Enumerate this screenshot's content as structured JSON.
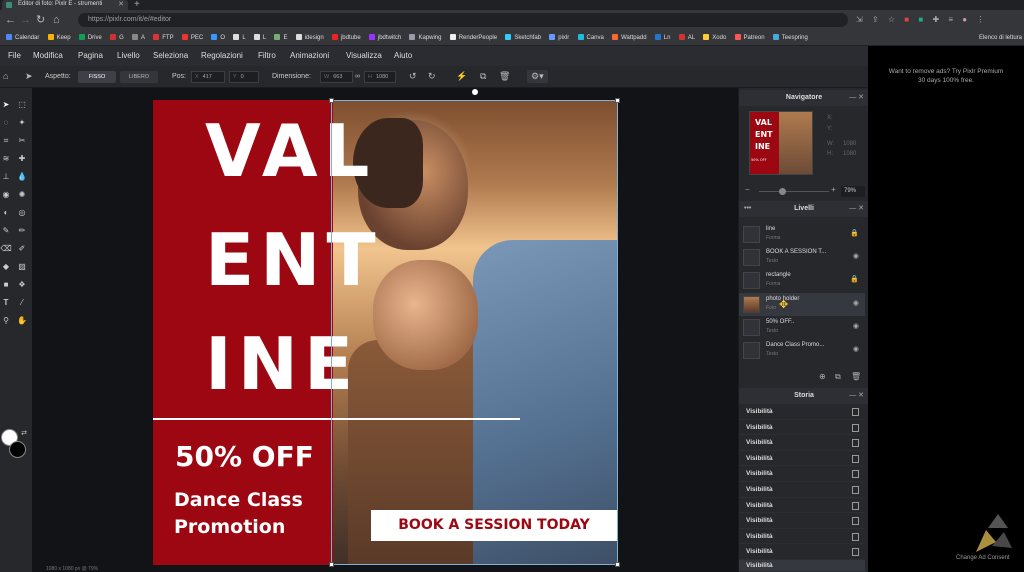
{
  "browser": {
    "tab_title": "Editor di foto: Pixlr E - strumenti",
    "url": "https://pixlr.com/it/e/#editor",
    "bookmarks": [
      "Calendar",
      "Keep",
      "Drive",
      "G",
      "A",
      "FTP",
      "PEC",
      "O",
      "L",
      "L",
      "E",
      "idesign",
      "jbdtube",
      "jbdtwitch",
      "Kapwing",
      "RenderPeople",
      "Sketchfab",
      "pixlr",
      "Canva",
      "Wattpadd",
      "Ln",
      "AL",
      "Xodo",
      "Patreon",
      "Teespring"
    ],
    "bookmarks_end": "Elenco di lettura"
  },
  "menu": [
    "File",
    "Modifica",
    "Pagina",
    "Livello",
    "Seleziona",
    "Regolazioni",
    "Filtro",
    "Animazioni",
    "Visualizza",
    "Aiuto"
  ],
  "toolbar": {
    "aspect_label": "Aspetto:",
    "fixed": "FISSO",
    "free": "LIBERO",
    "pos_label": "Pos:",
    "x_label": "X",
    "x_value": "417",
    "y_label": "Y",
    "y_value": "0",
    "size_label": "Dimensione:",
    "w_label": "W",
    "w_value": "663",
    "h_label": "H",
    "h_value": "1080"
  },
  "canvas": {
    "title_lines": [
      "VAL",
      "ENT",
      "INE"
    ],
    "offer": "50% OFF",
    "line1": "Dance Class",
    "line2": "Promotion",
    "cta": "BOOK A SESSION TODAY",
    "status": "1080 x 1080 px @ 79%"
  },
  "navigator": {
    "title": "Navigatore",
    "x": "X:",
    "y": "Y:",
    "w_label": "W:",
    "w_value": "1080",
    "h_label": "H:",
    "h_value": "1080",
    "zoom": "79%",
    "thumb_title": "VAL ENT INE",
    "thumb_offer": "50% OFF"
  },
  "layers": {
    "title": "Livelli",
    "items": [
      {
        "name": "line",
        "type": "Forma",
        "icon": "lock-icon"
      },
      {
        "name": "BOOK A SESSION T...",
        "type": "Testo",
        "icon": "eye-icon"
      },
      {
        "name": "rectangle",
        "type": "Forma",
        "icon": "lock-icon"
      },
      {
        "name": "photo holder",
        "type": "Foto",
        "icon": "eye-icon",
        "selected": true
      },
      {
        "name": "50% OFF..",
        "type": "Testo",
        "icon": "eye-icon"
      },
      {
        "name": "Dance Class Promo...",
        "type": "Testo",
        "icon": "eye-icon"
      }
    ]
  },
  "history": {
    "title": "Storia",
    "items": [
      "Visibilità",
      "Visibilità",
      "Visibilità",
      "Visibilità",
      "Visibilità",
      "Visibilità",
      "Visibilità",
      "Visibilità",
      "Visibilità",
      "Visibilità",
      "Visibilità"
    ]
  },
  "ad": {
    "text1": "Want to remove ads? Try Pixlr Premium",
    "text2": "30 days 100% free.",
    "consent": "Change Ad Consent"
  },
  "colors": {
    "brand_red": "#9c0712",
    "panel": "#26282c"
  }
}
